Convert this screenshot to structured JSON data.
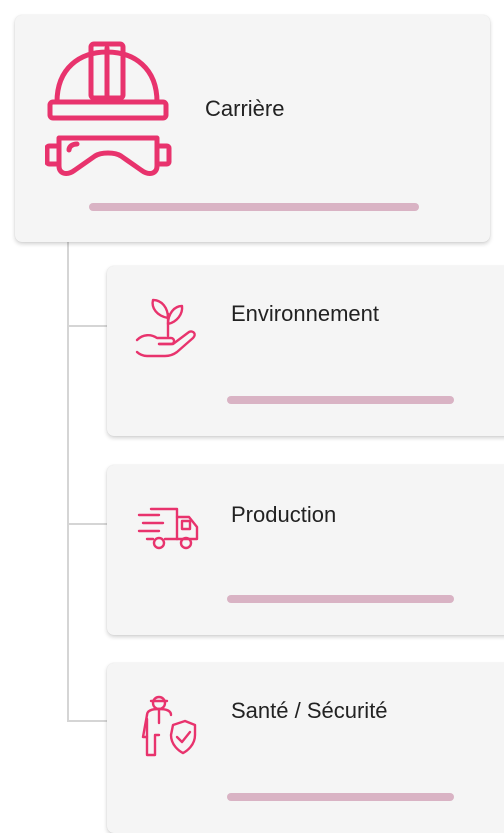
{
  "colors": {
    "accent": "#e8336d",
    "progress_bar": "#d9b3c4",
    "card_bg": "#f5f5f5",
    "tree_line": "#d5d5d5"
  },
  "root": {
    "label": "Carrière",
    "icon": "hard-hat-goggles-icon"
  },
  "children": [
    {
      "label": "Environnement",
      "icon": "hand-plant-icon"
    },
    {
      "label": "Production",
      "icon": "delivery-truck-icon"
    },
    {
      "label": "Santé / Sécurité",
      "icon": "worker-shield-icon"
    }
  ]
}
